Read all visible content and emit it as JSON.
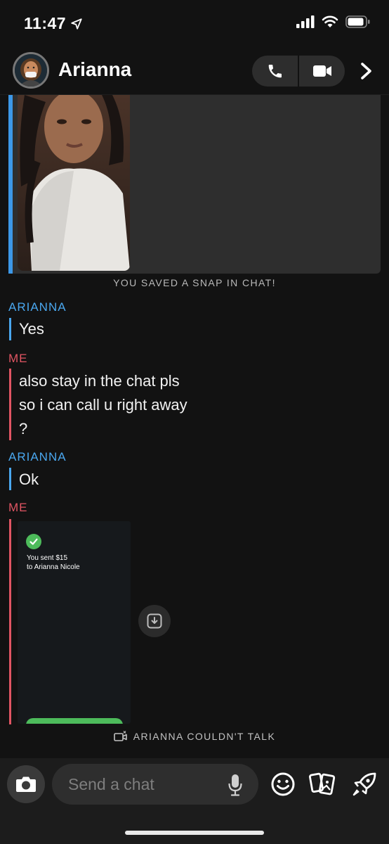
{
  "status_bar": {
    "time": "11:47"
  },
  "header": {
    "contact_name": "Arianna"
  },
  "messages": {
    "saved_snap_note": "YOU SAVED A SNAP IN CHAT!",
    "group1_sender": "ARIANNA",
    "group1_line1": "Yes",
    "group2_sender": "ME",
    "group2_line1": "also stay in the chat pls",
    "group2_line2": "so i can call u right away",
    "group2_line3": "?",
    "group3_sender": "ARIANNA",
    "group3_line1": "Ok",
    "group4_sender": "ME"
  },
  "payment_card": {
    "line1": "You sent $15",
    "line2": "to Arianna Nicole"
  },
  "missed_call_note": "ARIANNA COULDN'T TALK",
  "composer": {
    "placeholder": "Send a chat"
  },
  "colors": {
    "arianna": "#4aa7ef",
    "me": "#e15563",
    "background": "#121212",
    "payment_green": "#4dbb5b"
  },
  "icons": [
    "location-arrow-icon",
    "signal-icon",
    "wifi-icon",
    "battery-icon",
    "phone-icon",
    "video-icon",
    "chevron-right-icon",
    "download-icon",
    "video-call-missed-icon",
    "camera-icon",
    "microphone-icon",
    "emoji-icon",
    "cards-icon",
    "rocket-icon",
    "check-icon"
  ]
}
